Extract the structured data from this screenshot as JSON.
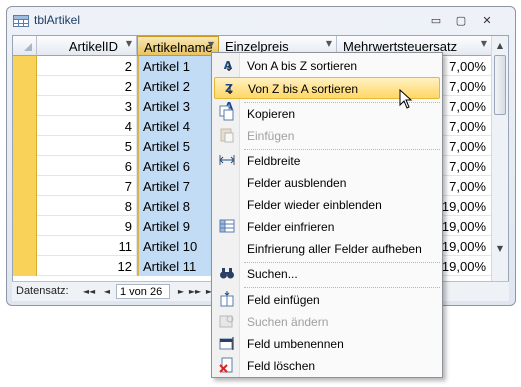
{
  "window": {
    "title": "tblArtikel",
    "controls": {
      "minimize": "▭",
      "maximize": "▢",
      "close": "✕"
    }
  },
  "table": {
    "columns": [
      "ArtikelID",
      "Artikelname",
      "Einzelpreis",
      "Mehrwertsteuersatz"
    ],
    "rows": [
      {
        "id": "2",
        "name": "Artikel 1",
        "mwst": "7,00%"
      },
      {
        "id": "2",
        "name": "Artikel 2",
        "mwst": "7,00%"
      },
      {
        "id": "3",
        "name": "Artikel 3",
        "mwst": "7,00%"
      },
      {
        "id": "4",
        "name": "Artikel 4",
        "mwst": "7,00%"
      },
      {
        "id": "5",
        "name": "Artikel 5",
        "mwst": "7,00%"
      },
      {
        "id": "6",
        "name": "Artikel 6",
        "mwst": "7,00%"
      },
      {
        "id": "7",
        "name": "Artikel 7",
        "mwst": "7,00%"
      },
      {
        "id": "8",
        "name": "Artikel 8",
        "mwst": "19,00%"
      },
      {
        "id": "9",
        "name": "Artikel 9",
        "mwst": "19,00%"
      },
      {
        "id": "11",
        "name": "Artikel 10",
        "mwst": "19,00%"
      },
      {
        "id": "12",
        "name": "Artikel 11",
        "mwst": "19,00%"
      }
    ]
  },
  "navigation": {
    "label": "Datensatz:",
    "record": "1 von 26",
    "buttons": {
      "first": "◄◄",
      "prev": "◄",
      "next": "►",
      "last": "►►",
      "new": "►*"
    }
  },
  "context_menu": {
    "items": [
      {
        "label": "Von A bis Z sortieren",
        "icon": "sort-ascending-icon",
        "enabled": true
      },
      {
        "label": "Von Z bis A sortieren",
        "icon": "sort-descending-icon",
        "enabled": true,
        "highlighted": true
      },
      {
        "label": "Kopieren",
        "icon": "copy-icon",
        "enabled": true
      },
      {
        "label": "Einfügen",
        "icon": "paste-icon",
        "enabled": false
      },
      {
        "label": "Feldbreite",
        "icon": "column-width-icon",
        "enabled": true
      },
      {
        "label": "Felder ausblenden",
        "icon": "",
        "enabled": true
      },
      {
        "label": "Felder wieder einblenden",
        "icon": "",
        "enabled": true
      },
      {
        "label": "Felder einfrieren",
        "icon": "freeze-fields-icon",
        "enabled": true
      },
      {
        "label": "Einfrierung aller Felder aufheben",
        "icon": "",
        "enabled": true
      },
      {
        "label": "Suchen...",
        "icon": "binoculars-icon",
        "enabled": true
      },
      {
        "label": "Feld einfügen",
        "icon": "insert-field-icon",
        "enabled": true
      },
      {
        "label": "Suchen ändern",
        "icon": "lookup-icon",
        "enabled": false
      },
      {
        "label": "Feld umbenennen",
        "icon": "rename-field-icon",
        "enabled": true
      },
      {
        "label": "Feld löschen",
        "icon": "delete-field-icon",
        "enabled": true
      }
    ]
  },
  "colors": {
    "selected_column": "#c3dcf6",
    "row_selector": "#f9d25a",
    "menu_highlight": "#ffd766"
  }
}
